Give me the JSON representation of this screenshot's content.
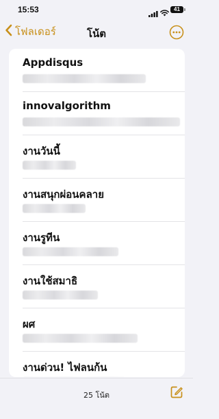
{
  "status_bar": {
    "time": "15:53",
    "battery": "41",
    "icons": [
      "cellular-signal-icon",
      "wifi-icon",
      "battery-icon"
    ]
  },
  "nav": {
    "back_label": "โฟลเดอร์",
    "title": "โน้ต",
    "accent_color": "#c8901a"
  },
  "notes": [
    {
      "title": "Appdisqus"
    },
    {
      "title": "innovalgorithm"
    },
    {
      "title": "งานวันนี้"
    },
    {
      "title": "งานสนุกผ่อนคลาย"
    },
    {
      "title": "งานรูทีน"
    },
    {
      "title": "งานใช้สมาธิ"
    },
    {
      "title": "ผศ"
    },
    {
      "title": "งานด่วน! ไฟลนก้น"
    }
  ],
  "toolbar": {
    "count_label": "25 โน้ต"
  }
}
